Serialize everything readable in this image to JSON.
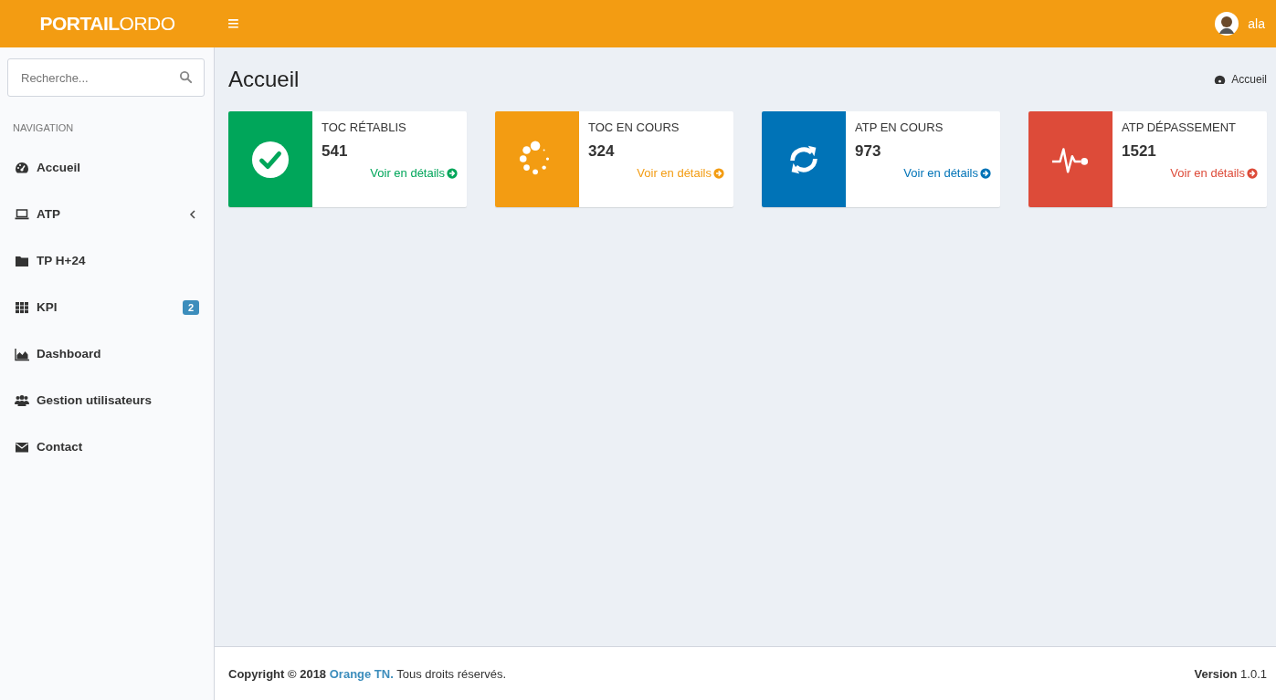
{
  "header": {
    "logo": "**PORTAIL**ORDO",
    "menu_toggle": "≡",
    "user": {
      "name": "ala"
    }
  },
  "sidebar": {
    "search": {
      "placeholder": "Recherche..."
    },
    "section_label": "NAVIGATION",
    "items": [
      {
        "label": "Accueil",
        "kind": "gauge"
      },
      {
        "label": "ATP",
        "kind": "laptop",
        "expanded": false
      },
      {
        "label": "TP H+24",
        "kind": "folder"
      },
      {
        "label": "KPI",
        "kind": "grid",
        "badge": "2"
      },
      {
        "label": "Dashboard",
        "kind": "area"
      },
      {
        "label": "Gestion utilisateurs",
        "kind": "users"
      },
      {
        "label": "Contact",
        "kind": "envelope"
      }
    ]
  },
  "page": {
    "title": "Accueil",
    "breadcrumb": "Accueil"
  },
  "cards": [
    {
      "title": "TOC RÉTABLIS",
      "value": "541",
      "link": "Voir en détails",
      "kind": "check",
      "color": "#00a65a"
    },
    {
      "title": "TOC EN COURS",
      "value": "324",
      "link": "Voir en détails",
      "kind": "spinner",
      "color": "#f39c12"
    },
    {
      "title": "ATP EN COURS",
      "value": "973",
      "link": "Voir en détails",
      "kind": "refresh",
      "color": "#0073b7"
    },
    {
      "title": "ATP DÉPASSEMENT",
      "value": "1521",
      "link": "Voir en détails",
      "kind": "heartbeat",
      "color": "#dd4b39"
    }
  ],
  "footer": {
    "copyright": "Copyright © 2018",
    "company": "Orange TN.",
    "rights": "Tous droits réservés.",
    "version": "**Version** 1.0.1"
  }
}
